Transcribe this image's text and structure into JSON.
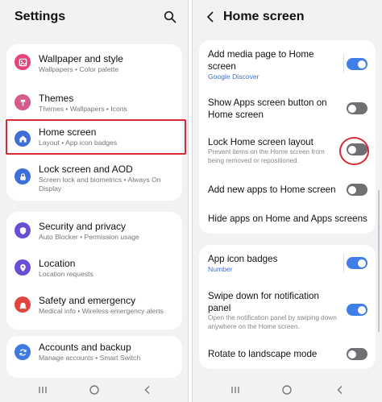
{
  "settings": {
    "title": "Settings",
    "items": [
      {
        "label": "Wallpaper and style",
        "sub": "Wallpapers • Color palette",
        "icon": "wallpaper-icon",
        "color": "#e8447a"
      },
      {
        "label": "Themes",
        "sub": "Themes • Wallpapers • Icons",
        "icon": "themes-icon",
        "color": "#d85a8d"
      },
      {
        "label": "Home screen",
        "sub": "Layout • App icon badges",
        "icon": "home-icon",
        "color": "#3e6fd8"
      },
      {
        "label": "Lock screen and AOD",
        "sub": "Screen lock and biometrics • Always On Display",
        "icon": "lock-icon",
        "color": "#3e6fd8"
      },
      {
        "label": "Security and privacy",
        "sub": "Auto Blocker • Permission usage",
        "icon": "shield-icon",
        "color": "#6a4fd6"
      },
      {
        "label": "Location",
        "sub": "Location requests",
        "icon": "location-icon",
        "color": "#6a4fd6"
      },
      {
        "label": "Safety and emergency",
        "sub": "Medical info • Wireless emergency alerts",
        "icon": "emergency-icon",
        "color": "#e0453f"
      },
      {
        "label": "Accounts and backup",
        "sub": "Manage accounts • Smart Switch",
        "icon": "sync-icon",
        "color": "#3e7be0"
      }
    ]
  },
  "home_screen": {
    "title": "Home screen",
    "items": [
      {
        "label": "Add media page to Home screen",
        "link": "Google Discover",
        "on": true
      },
      {
        "label": "Show Apps screen button on Home screen",
        "on": false
      },
      {
        "label": "Lock Home screen layout",
        "sub": "Prevent items on the Home screen from being removed or repositioned.",
        "on": false
      },
      {
        "label": "Add new apps to Home screen",
        "on": false
      },
      {
        "label": "Hide apps on Home and Apps screens"
      },
      {
        "label": "App icon badges",
        "link": "Number",
        "on": true
      },
      {
        "label": "Swipe down for notification panel",
        "sub": "Open the notification panel by swiping down anywhere on the Home screen.",
        "on": true
      },
      {
        "label": "Rotate to landscape mode",
        "on": false
      }
    ]
  },
  "colors": {
    "highlight": "#d62a35",
    "toggle_on": "#3e7ee6",
    "toggle_off": "#6f6f74",
    "link": "#3b6fd6"
  }
}
